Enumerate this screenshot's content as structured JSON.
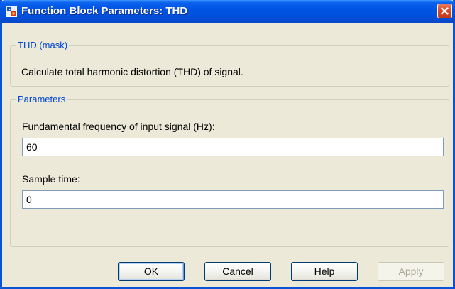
{
  "window": {
    "title": "Function Block Parameters: THD",
    "icon": "simulink-block-icon",
    "close_icon": "close-icon"
  },
  "mask_group": {
    "legend": "THD (mask)",
    "description": "Calculate total harmonic distortion (THD) of signal."
  },
  "params_group": {
    "legend": "Parameters",
    "fields": [
      {
        "label": "Fundamental frequency of input signal (Hz):",
        "value": "60"
      },
      {
        "label": "Sample time:",
        "value": "0"
      }
    ]
  },
  "buttons": {
    "ok": "OK",
    "cancel": "Cancel",
    "help": "Help",
    "apply": "Apply"
  },
  "colors": {
    "titlebar": "#0054e3",
    "legend_text": "#0046d5",
    "close_button": "#d94a28",
    "dialog_background": "#ece9d8"
  }
}
